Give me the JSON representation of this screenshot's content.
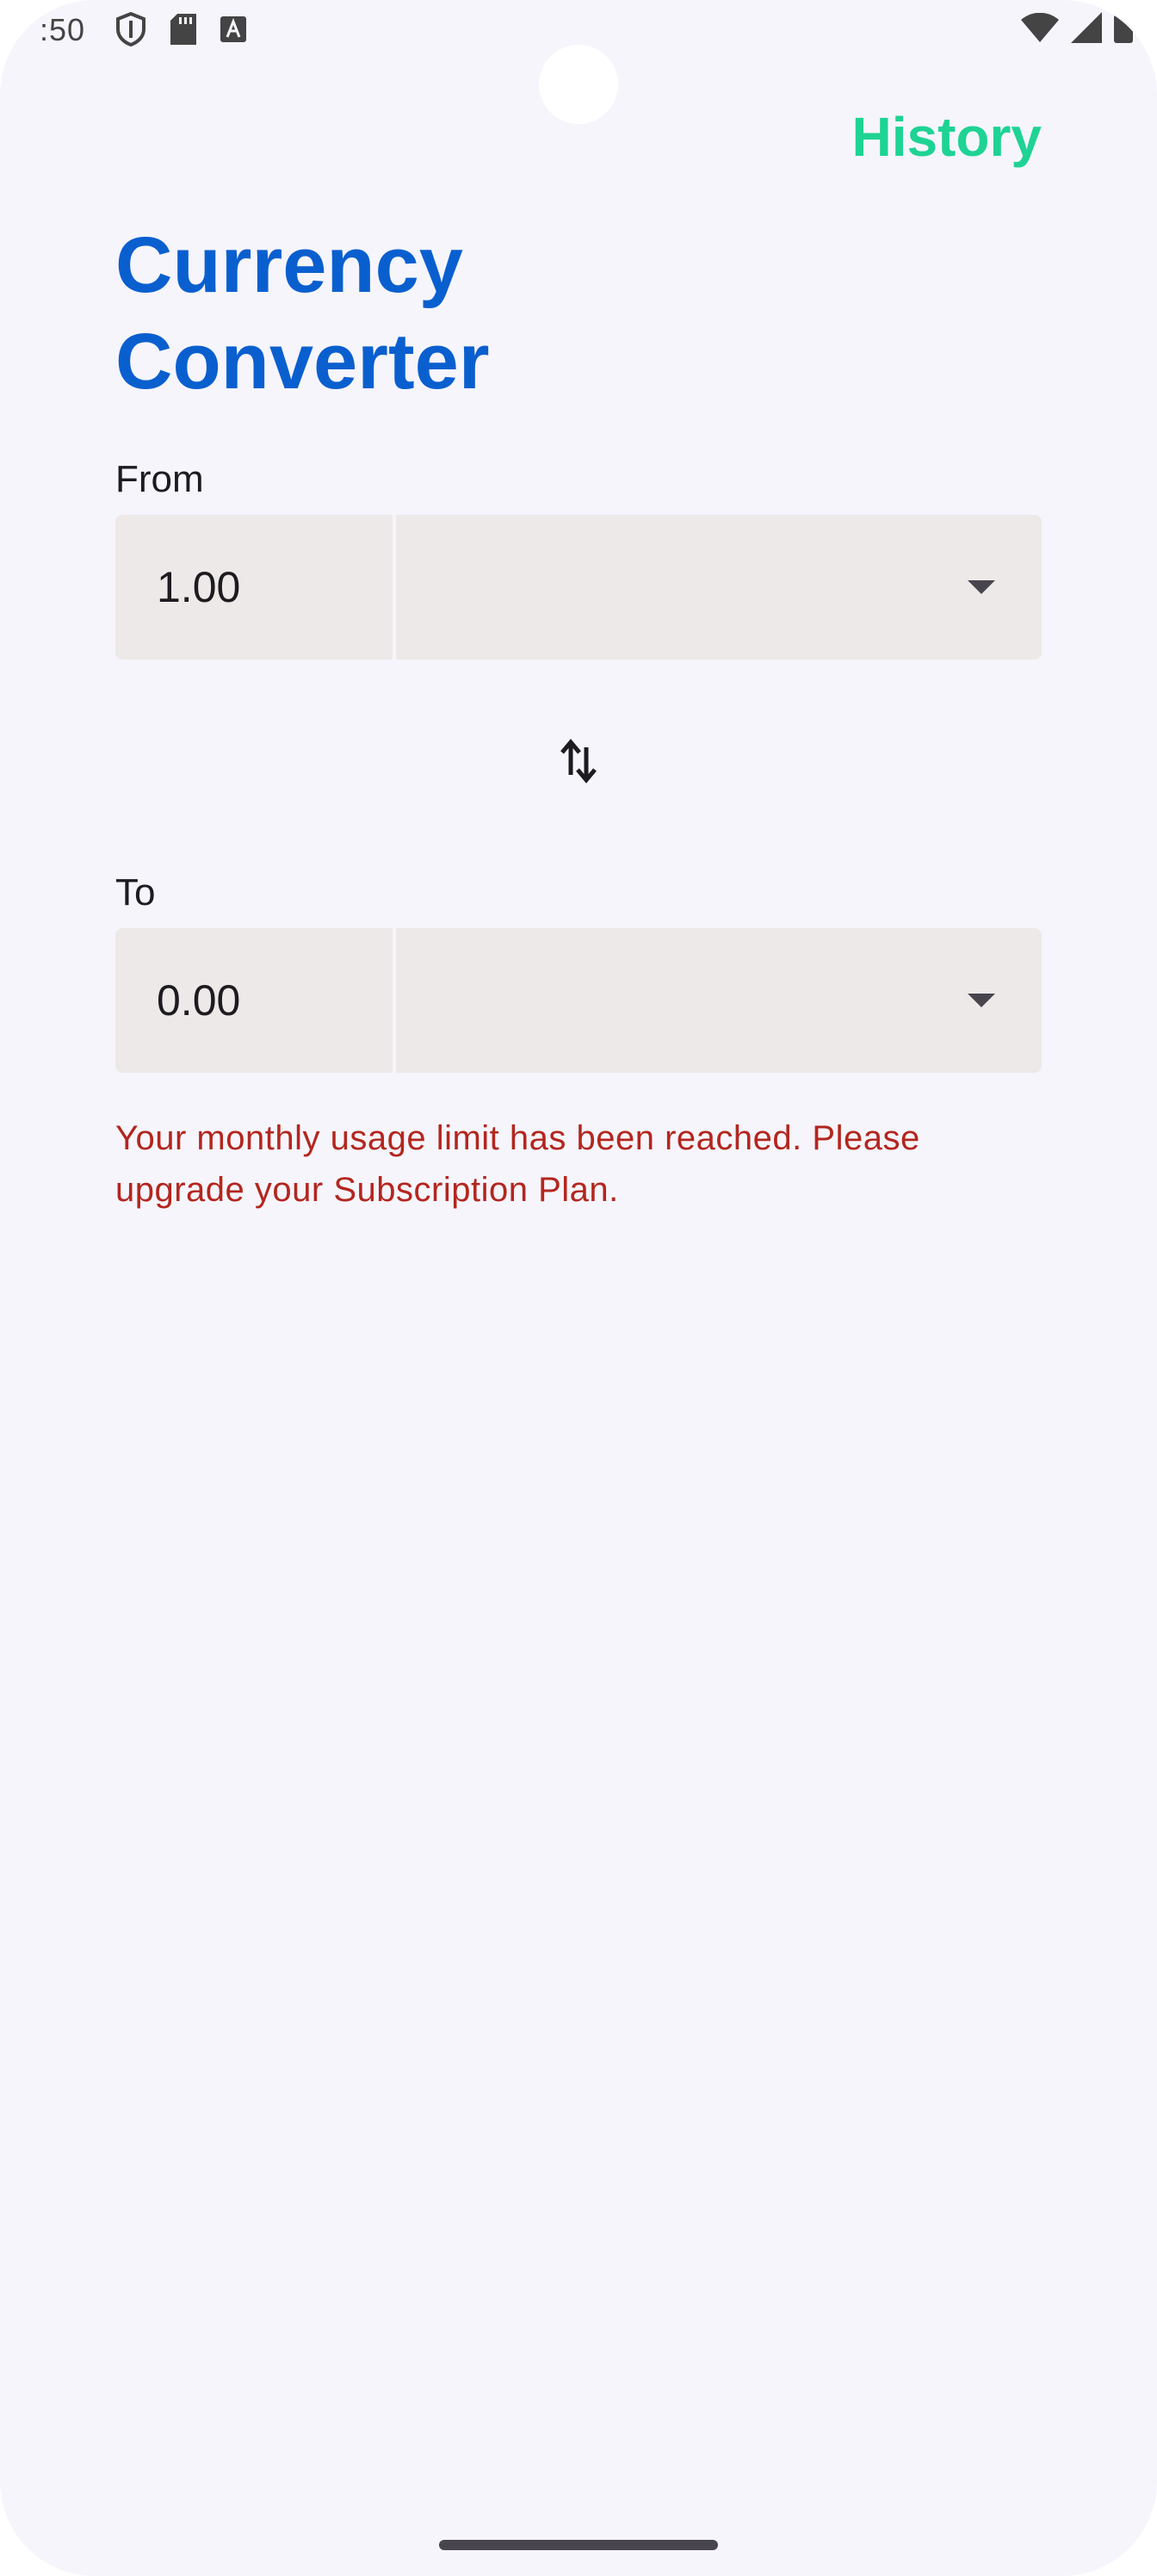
{
  "status_bar": {
    "time": ":50",
    "icons_left": [
      "shield-icon",
      "sd-card-icon",
      "font-icon"
    ],
    "icons_right": [
      "wifi-icon",
      "signal-icon",
      "battery-icon"
    ]
  },
  "header": {
    "history_label": "History",
    "title": "Currency Converter"
  },
  "from": {
    "label": "From",
    "amount": "1.00",
    "currency": ""
  },
  "to": {
    "label": "To",
    "amount": "0.00",
    "currency": ""
  },
  "error_message": "Your monthly usage limit has been reached. Please upgrade your Subscription Plan.",
  "colors": {
    "accent_title": "#0a5fcf",
    "history_link": "#1ed394",
    "error": "#b3261e",
    "field_bg": "#ede9e8",
    "background": "#f6f5fc"
  }
}
